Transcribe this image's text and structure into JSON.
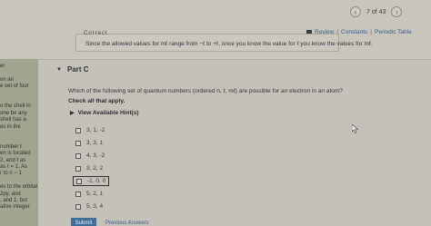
{
  "pager": {
    "prev_icon": "chevron-left-icon",
    "count": "7 of 43",
    "next_icon": "chevron-right-icon"
  },
  "resources": {
    "review": "Review",
    "constants": "Constants",
    "periodic_table": "Periodic Table",
    "separator": "|"
  },
  "hint_box": {
    "title_clipped": "Correct",
    "message": "Since the allowed values for mℓ range from −ℓ to +ℓ, once you know the value for ℓ you know the values for mℓ."
  },
  "sidebar": {
    "lines": [
      "er",
      "",
      "on an",
      "e set of four",
      "",
      "",
      "o the shell in",
      "one be any",
      "shell has a",
      "es in the",
      "",
      "",
      "number ℓ",
      "en is located",
      "2, and ℓ as",
      "as ℓ = 1. As",
      "r to n − 1",
      "",
      "es to the orbital",
      "2py, and",
      ", and 1, but",
      "ative integer"
    ]
  },
  "part": {
    "caret": "▼",
    "label": "Part C"
  },
  "question": {
    "text": "Which of the following set of quantum numbers (ordered n, ℓ, mℓ) are possible for an electron in an atom?",
    "instruction": "Check all that apply."
  },
  "hints": {
    "label": "View Available Hint(s)",
    "caret": "▶"
  },
  "options": [
    {
      "label": "3, 1, -2",
      "checked": false
    },
    {
      "label": "3, 3, 1",
      "checked": false
    },
    {
      "label": "4, 3, -2",
      "checked": false
    },
    {
      "label": "3, 2, 2",
      "checked": false
    },
    {
      "label": "-1, 0, 0",
      "checked": false,
      "focused": true
    },
    {
      "label": "5, 2, 1",
      "checked": false
    },
    {
      "label": "5, 3, 4",
      "checked": false
    }
  ],
  "footer": {
    "submit": "Submit",
    "previous": "Previous Answers"
  }
}
